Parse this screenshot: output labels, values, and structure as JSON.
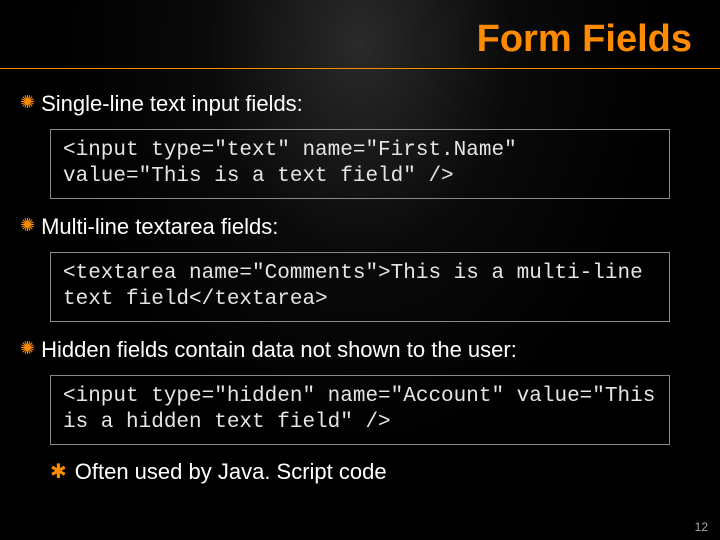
{
  "title": "Form Fields",
  "bullets": [
    {
      "text": "Single-line text input fields:",
      "code": "<input type=\"text\" name=\"First.Name\" value=\"This is a text field\" />"
    },
    {
      "text": "Multi-line textarea fields:",
      "code": "<textarea name=\"Comments\">This is a multi-line text field</textarea>"
    },
    {
      "text": "Hidden fields contain data not shown to the user:",
      "code": "<input type=\"hidden\" name=\"Account\" value=\"This is a hidden text field\" />"
    }
  ],
  "subBullet": "Often used by Java. Script code",
  "pageNumber": "12"
}
